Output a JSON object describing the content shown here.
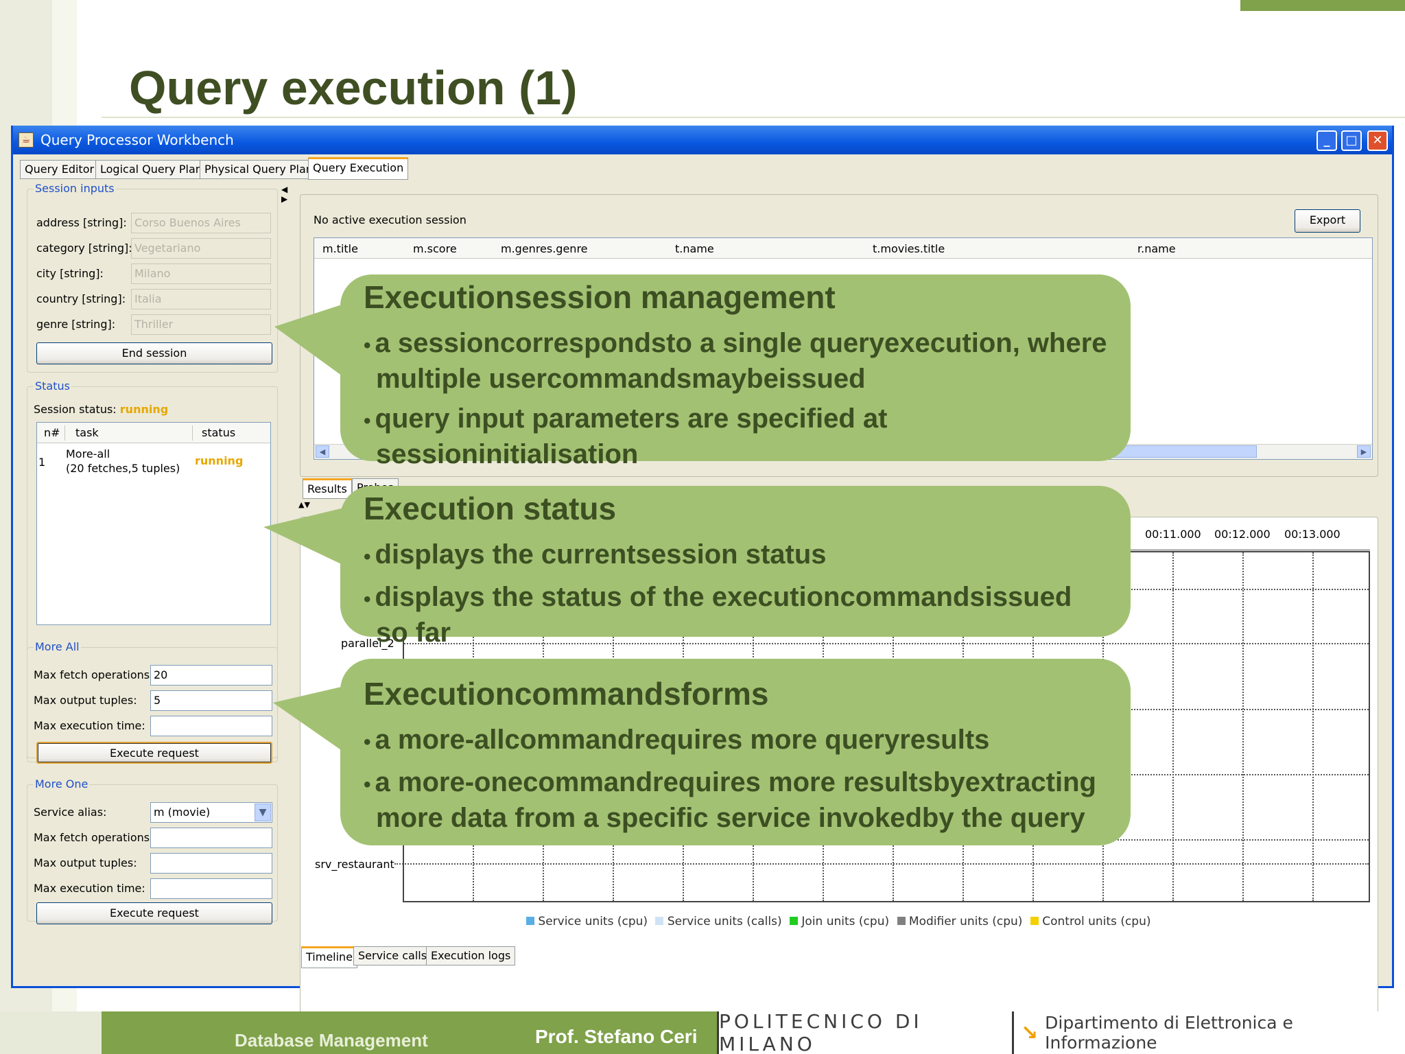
{
  "slide": {
    "title": "Query execution (1)",
    "footer_left": "Database Management",
    "footer_author": "Prof. Stefano Ceri",
    "footer_institution": "POLITECNICO DI MILANO",
    "footer_department": "Dipartimento di Elettronica e Informazione",
    "accent_color": "#7fa24a"
  },
  "window": {
    "title": "Query Processor Workbench",
    "tabs": [
      "Query Editor",
      "Logical Query Plan",
      "Physical Query Plan",
      "Query Execution"
    ],
    "active_tab": "Query Execution"
  },
  "session_inputs": {
    "label": "Session inputs",
    "fields": [
      {
        "label": "address [string]:",
        "value": "Corso Buenos Aires"
      },
      {
        "label": "category [string]:",
        "value": "Vegetariano"
      },
      {
        "label": "city [string]:",
        "value": "Milano"
      },
      {
        "label": "country [string]:",
        "value": "Italia"
      },
      {
        "label": "genre [string]:",
        "value": "Thriller"
      }
    ],
    "end_button": "End session"
  },
  "status": {
    "label": "Status",
    "session_status_label": "Session status:",
    "session_status_value": "running",
    "table_headers": [
      "n#",
      "task",
      "status"
    ],
    "rows": [
      {
        "n": "1",
        "task_line1": "More-all",
        "task_line2": "(20 fetches,5 tuples)",
        "status": "running"
      }
    ]
  },
  "more_all": {
    "label": "More All",
    "fetch_label": "Max fetch operations:",
    "fetch_value": "20",
    "tuples_label": "Max output tuples:",
    "tuples_value": "5",
    "time_label": "Max execution time:",
    "time_value": "",
    "execute_button": "Execute request"
  },
  "more_one": {
    "label": "More One",
    "alias_label": "Service alias:",
    "alias_value": "m (movie)",
    "fetch_label": "Max fetch operations:",
    "tuples_label": "Max output tuples:",
    "time_label": "Max execution time:",
    "execute_button": "Execute request"
  },
  "results": {
    "no_session_text": "No active execution session",
    "export_button": "Export",
    "columns": [
      "m.title",
      "m.score",
      "m.genres.genre",
      "t.name",
      "t.movies.title",
      "r.name"
    ],
    "tabs": [
      "Results",
      "Probes"
    ]
  },
  "timeline": {
    "tick_labels": [
      "00:11.000",
      "00:12.000",
      "00:13.000"
    ],
    "row_labels": [
      "parallel_2",
      "srv_restaurant"
    ],
    "legend": [
      "Service units (cpu)",
      "Service units (calls)",
      "Join units (cpu)",
      "Modifier units (cpu)",
      "Control units (cpu)"
    ],
    "legend_colors": [
      "#5aaee6",
      "#cfe3f5",
      "#22cc22",
      "#808080",
      "#f5d000"
    ],
    "bottom_tabs": [
      "Timeline",
      "Service calls",
      "Execution logs"
    ]
  },
  "callouts": [
    {
      "title": "Executionsession management",
      "bullets": [
        "a sessioncorrespondsto a single queryexecution, where multiple usercommandsmaybeissued",
        "query input parameters are specified at sessioninitialisation"
      ]
    },
    {
      "title": "Execution status",
      "bullets": [
        "displays the currentsession status",
        "displays the status of the executioncommandsissued so far"
      ]
    },
    {
      "title": "Executioncommandsforms",
      "bullets": [
        "a more-allcommandrequires more queryresults",
        "a more-onecommandrequires more resultsbyextracting more data from a specific service invokedby the query"
      ]
    }
  ]
}
